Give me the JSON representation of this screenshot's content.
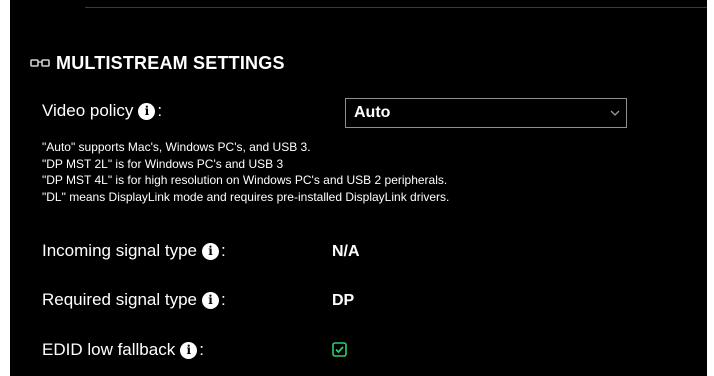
{
  "section": {
    "icon": "glasses-icon",
    "title": "MULTISTREAM SETTINGS"
  },
  "video_policy": {
    "label": "Video policy",
    "colon": ":",
    "selected": "Auto",
    "notes": [
      "\"Auto\" supports Mac's, Windows PC's, and USB 3.",
      "\"DP MST 2L\" is for Windows PC's and USB 3",
      "\"DP MST 4L\" is for high resolution on Windows PC's and USB 2 peripherals.",
      "\"DL\" means DisplayLink mode and requires pre-installed DisplayLink drivers."
    ]
  },
  "incoming_signal": {
    "label": "Incoming signal type",
    "colon": ":",
    "value": "N/A"
  },
  "required_signal": {
    "label": "Required signal type",
    "colon": ":",
    "value": "DP"
  },
  "edid_fallback": {
    "label": "EDID low fallback",
    "colon": ":",
    "checked": true
  },
  "info_glyph": "i",
  "colors": {
    "background": "#000000",
    "text": "#ffffff",
    "accent_check": "#2ecc71",
    "select_border": "#8f8f8f"
  }
}
